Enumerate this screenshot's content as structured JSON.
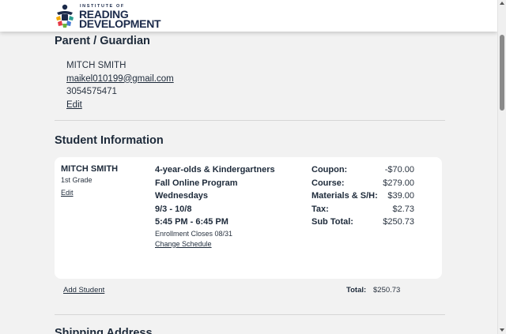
{
  "header": {
    "logo_small": "INSTITUTE OF",
    "logo_line1": "READING",
    "logo_line2": "DEVELOPMENT"
  },
  "parent": {
    "title": "Parent / Guardian",
    "name": "MITCH SMITH",
    "email": "maikel010199@gmail.com",
    "phone": "3054575471",
    "edit_label": "Edit"
  },
  "student_section": {
    "title": "Student Information",
    "student": {
      "name": "MITCH SMITH",
      "grade": "1st Grade",
      "edit_label": "Edit"
    },
    "program": {
      "age_group": "4-year-olds & Kindergartners",
      "program_name": "Fall Online Program",
      "day": "Wednesdays",
      "dates": "9/3 - 10/8",
      "time": "5:45 PM - 6:45 PM",
      "enrollment_note": "Enrollment Closes 08/31",
      "change_schedule_label": "Change Schedule"
    },
    "fees": [
      {
        "label": "Coupon:",
        "value": "-$70.00"
      },
      {
        "label": "Course:",
        "value": "$279.00"
      },
      {
        "label": "Materials & S/H:",
        "value": "$39.00"
      },
      {
        "label": "Tax:",
        "value": "$2.73"
      },
      {
        "label": "Sub Total:",
        "value": "$250.73"
      }
    ],
    "add_student_label": "Add Student",
    "total_label": "Total:",
    "total_value": "$250.73"
  },
  "shipping": {
    "title": "Shipping Address"
  },
  "colors": {
    "background": "#f2f2f2",
    "card": "#ffffff",
    "text": "#1d2a3a"
  }
}
